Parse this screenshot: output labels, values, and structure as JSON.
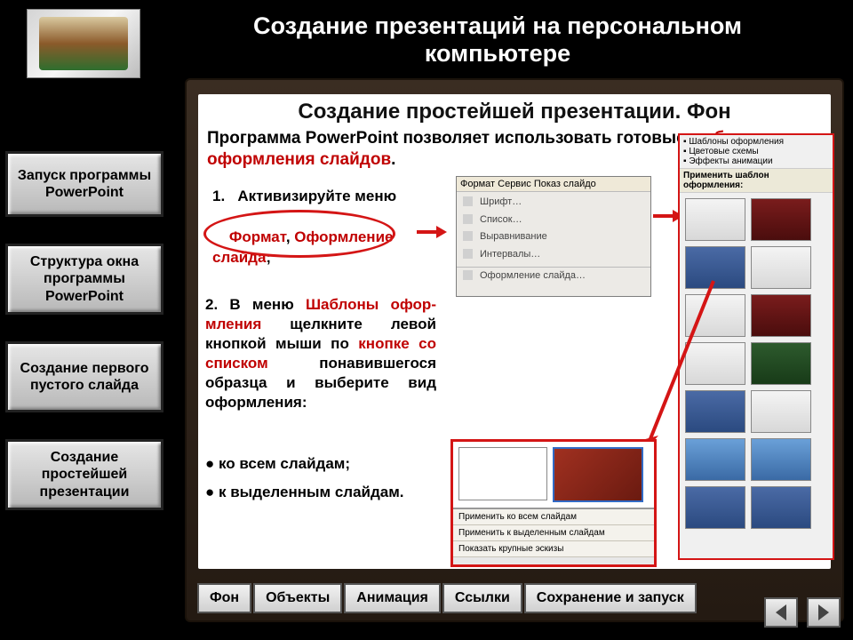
{
  "header": {
    "title": "Создание презентаций на персональном компьютере"
  },
  "sidebar": {
    "items": [
      "Запуск программы PowerPoint",
      "Структура окна программы PowerPoint",
      "Создание первого пустого слайда",
      "Создание простейшей презентации"
    ]
  },
  "canvas": {
    "title": "Создание простейшей презентации. Фон",
    "intro_prefix": "Программа PowerPoint позволяет использовать готовые ",
    "intro_red": "шаблоны оформления слайдов",
    "intro_suffix": ".",
    "step1_num": "1.",
    "step1_line1": "Активизируйте меню",
    "step1_red1": "Формат",
    "step1_comma": ", ",
    "step1_red2": "Оформление слайда",
    "step1_tail": ";",
    "step2_p1a": "2. В меню ",
    "step2_red1": "Шаблоны офор­мления",
    "step2_p1b": " щелкните левой кнопкой мыши по ",
    "step2_red2": "кнопке со списком",
    "step2_p1c": " понавившегося образца и выберите вид оформления:",
    "bullets": [
      "● ко всем слайдам;",
      "● к выделенным слайдам."
    ],
    "format_menu": {
      "bar": "Формат   Сервис   Показ слайдо",
      "items": [
        "Шрифт…",
        "Список…",
        "Выравнивание",
        "Интервалы…",
        "Оформление слайда…"
      ]
    },
    "template_pane": {
      "opt1": "Шаблоны оформления",
      "opt2": "Цветовые схемы",
      "opt3": "Эффекты анимации",
      "apply": "Применить шаблон оформления:"
    },
    "context_menu": {
      "items": [
        "Применить ко всем слайдам",
        "Применить к выделенным слайдам",
        "Показать крупные эскизы"
      ]
    }
  },
  "tabs": [
    "Фон",
    "Объекты",
    "Анимация",
    "Ссылки",
    "Сохранение и запуск"
  ]
}
